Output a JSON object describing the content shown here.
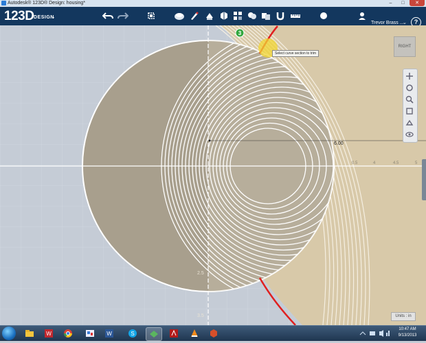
{
  "window": {
    "title": "Autodesk® 123D® Design: housing*",
    "min": "–",
    "max": "□",
    "close": "✕"
  },
  "toolbar": {
    "logo_main": "123D",
    "logo_sub": "DESIGN",
    "logo_chevron": "⌄",
    "tools": [
      "undo-icon",
      "redo-icon",
      "transform-icon",
      "primitives-icon",
      "sketch-icon",
      "construct-icon",
      "modify-icon",
      "pattern-icon",
      "group-icon",
      "combine-icon",
      "snap-icon",
      "measure-icon",
      "material-icon"
    ],
    "user_name": "Trevor Brass ...",
    "user_chevron": "⌄",
    "help_label": "?"
  },
  "canvas": {
    "tooltip": "Select curve section to trim",
    "dimension_value": "6.00",
    "viewcube_label": "RIGHT",
    "units_label": "Units : in",
    "axis_labels": [
      "0.5",
      "4",
      "4.5",
      "5",
      "2.5",
      "3.5"
    ],
    "colors": {
      "background": "#c5ccd6",
      "plane": "#d8c9a9",
      "sketch_fill": "#a89f8d",
      "sketch_lines": "#ffffff",
      "trim_curve": "#e02020",
      "highlight": "#f2d633",
      "step_badge": "#33a63e"
    },
    "step_badge": "3"
  },
  "navbar": {
    "buttons": [
      "pan-icon",
      "orbit-icon",
      "zoom-icon",
      "fit-icon",
      "perspective-icon",
      "visibility-icon"
    ]
  },
  "taskbar": {
    "apps": [
      "explorer-icon",
      "autodesk-icon",
      "chrome-icon",
      "paint-icon",
      "word-icon",
      "skype-icon",
      "123d-icon",
      "acrobat-icon",
      "vlc-icon",
      "sketchup-icon"
    ],
    "time": "10:47 AM",
    "date": "9/13/2013"
  }
}
